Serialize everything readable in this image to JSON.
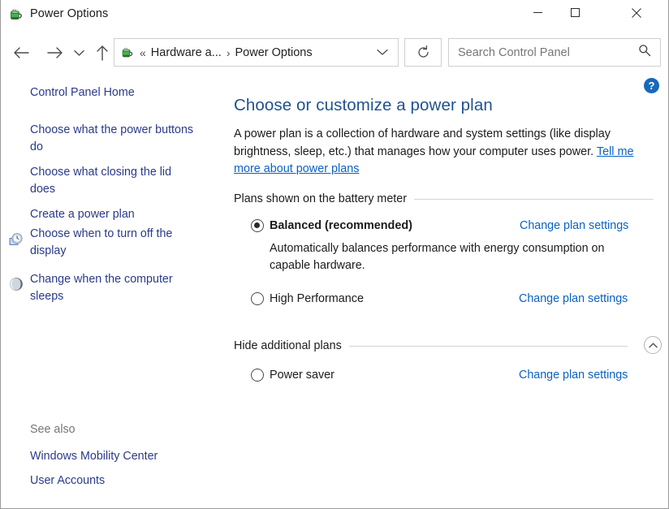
{
  "window": {
    "title": "Power Options",
    "app_icon": "power-plug-battery-icon",
    "controls": {
      "minimize": "Minimize",
      "maximize": "Maximize",
      "close": "Close"
    }
  },
  "navbar": {
    "back": "Back",
    "forward": "Forward",
    "recent": "Recent locations",
    "up": "Up one level",
    "breadcrumb": {
      "icon": "power-plug-battery-icon",
      "overflow": "«",
      "items": [
        "Hardware a...",
        "Power Options"
      ],
      "separator": "›",
      "dropdown": "Previous locations"
    },
    "refresh": "Refresh",
    "search": {
      "placeholder": "Search Control Panel",
      "value": "",
      "icon": "search-icon"
    }
  },
  "help": {
    "label": "?",
    "name": "Help"
  },
  "sidebar": {
    "items": [
      {
        "label": "Control Panel Home",
        "icon": null
      },
      {
        "label": "Choose what the power buttons do",
        "icon": null
      },
      {
        "label": "Choose what closing the lid does",
        "icon": null
      },
      {
        "label": "Create a power plan",
        "icon": null
      },
      {
        "label": "Choose when to turn off the display",
        "icon": "display-clock-icon"
      },
      {
        "label": "Change when the computer sleeps",
        "icon": "sleep-moon-icon"
      }
    ],
    "see_also": {
      "label": "See also",
      "items": [
        {
          "label": "Windows Mobility Center"
        },
        {
          "label": "User Accounts"
        }
      ]
    }
  },
  "main": {
    "title": "Choose or customize a power plan",
    "description_before": "A power plan is a collection of hardware and system settings (like display brightness, sleep, etc.) that manages how your computer uses power. ",
    "description_link": "Tell me more about power plans",
    "groups": [
      {
        "header": "Plans shown on the battery meter",
        "collapse_icon": null,
        "plans": [
          {
            "name": "Balanced (recommended)",
            "selected": true,
            "description": "Automatically balances performance with energy consumption on capable hardware.",
            "change_link": "Change plan settings"
          },
          {
            "name": "High Performance",
            "selected": false,
            "description": "",
            "change_link": "Change plan settings"
          }
        ]
      },
      {
        "header": "Hide additional plans",
        "collapse_icon": "chevron-up-icon",
        "plans": [
          {
            "name": "Power saver",
            "selected": false,
            "description": "",
            "change_link": "Change plan settings"
          }
        ]
      }
    ]
  },
  "colors": {
    "title_blue": "#20538f",
    "link_blue": "#0a62c4",
    "sidebar_link": "#2a3a8a",
    "help_blue": "#1669bb",
    "rule": "#d4d4d4"
  }
}
